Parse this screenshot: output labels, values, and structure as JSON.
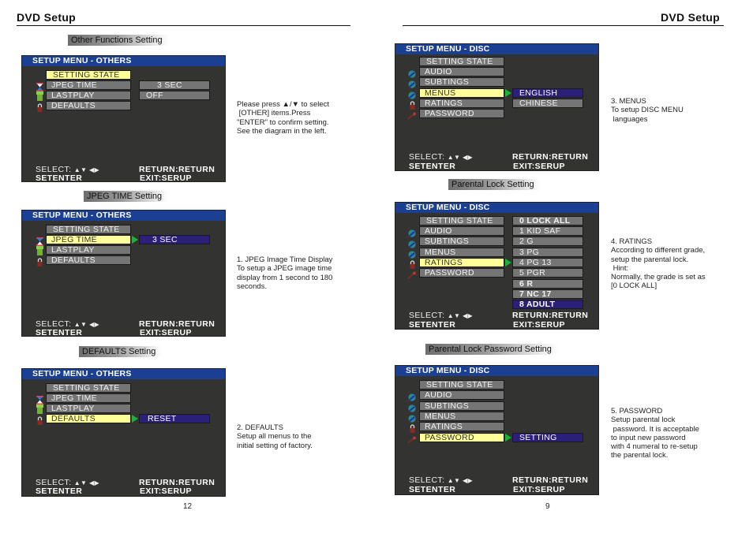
{
  "left_page": {
    "title": "DVD Setup",
    "page_number": "12",
    "sections": [
      {
        "caption": "Other Functions Setting",
        "osd": {
          "header": "SETUP MENU - OTHERS",
          "items": [
            "SETTING STATE",
            "JPEG TIME",
            "LASTPLAY",
            "DEFAULTS"
          ],
          "active_index": 0,
          "options": [
            "3  SEC",
            "OFF"
          ]
        },
        "description": "Please press ▲/▼ to select\n [OTHER] items.Press\n\"ENTER\" to confirm setting.\nSee the diagram in the left."
      },
      {
        "caption": "JPEG TIME Setting",
        "osd": {
          "header": "SETUP MENU - OTHERS",
          "items": [
            "SETTING STATE",
            "JPEG TIME",
            "LASTPLAY",
            "DEFAULTS"
          ],
          "active_index": 1,
          "options": [
            "3  SEC"
          ]
        },
        "description": "1. JPEG Image Time Display\nTo setup a JPEG image time\ndisplay from 1 second to 180\nseconds."
      },
      {
        "caption": "DEFAULTS Setting",
        "osd": {
          "header": "SETUP MENU - OTHERS",
          "items": [
            "SETTING STATE",
            "JPEG TIME",
            "LASTPLAY",
            "DEFAULTS"
          ],
          "active_index": 3,
          "options": [
            "RESET"
          ]
        },
        "description": "2. DEFAULTS\nSetup all menus to the\ninitial setting of factory."
      }
    ]
  },
  "right_page": {
    "title": "DVD Setup",
    "page_number": "9",
    "sections": [
      {
        "caption": "",
        "osd": {
          "header": "SETUP MENU - DISC",
          "items": [
            "SETTING STATE",
            "AUDIO",
            "SUBTINGS",
            "MENUS",
            "RATINGS",
            "PASSWORD"
          ],
          "active_index": 3,
          "options": [
            "ENGLISH",
            "CHINESE"
          ]
        },
        "description": "3. MENUS\nTo setup DISC MENU\n languages"
      },
      {
        "caption": "Parental Lock Setting",
        "osd": {
          "header": "SETUP MENU - DISC",
          "items": [
            "SETTING STATE",
            "AUDIO",
            "SUBTINGS",
            "MENUS",
            "RATINGS",
            "PASSWORD"
          ],
          "active_index": 4,
          "options": [
            "0 LOCK ALL",
            "1 KID SAF",
            "2 G",
            "3 PG",
            "4 PG 13",
            "5 PGR",
            "6 R",
            "7 NC 17",
            "8 ADULT"
          ]
        },
        "description": "4. RATINGS\nAccording to different grade,\nsetup the parental lock.\n Hint:\nNormally, the grade is set as\n[0 LOCK ALL]"
      },
      {
        "caption": "Parental Lock Password Setting",
        "osd": {
          "header": "SETUP MENU - DISC",
          "items": [
            "SETTING STATE",
            "AUDIO",
            "SUBTINGS",
            "MENUS",
            "RATINGS",
            "PASSWORD"
          ],
          "active_index": 5,
          "options": [
            "SETTING"
          ]
        },
        "description": "5. PASSWORD\nSetup parental lock\n password. It is acceptable\nto input new password\nwith 4 numeral to re-setup\nthe parental lock."
      }
    ]
  },
  "osd_footer": {
    "select": "SELECT:",
    "select_arrows": "▲▼ ◀▶",
    "setenter": "SETENTER",
    "return": "RETURN:RETURN",
    "exit": "EXIT:SERUP"
  },
  "colors": {
    "header_blue": "#1b3f93",
    "panel_bg": "#333331",
    "item_gray": "#757575",
    "active_yellow": "#ffff99",
    "selected_option": "#2b1f7a",
    "arrow_green": "#17b43a"
  }
}
